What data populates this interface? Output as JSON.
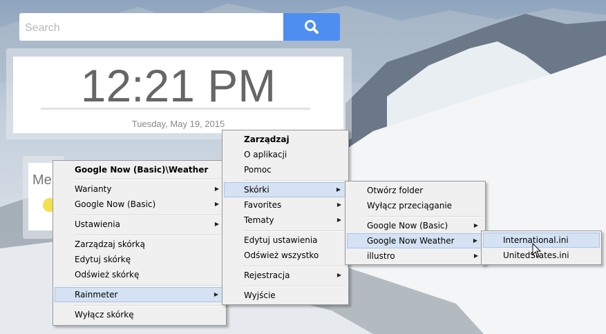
{
  "search": {
    "placeholder": "Search",
    "button_icon": "search-icon"
  },
  "clock": {
    "time": "12:21 PM",
    "date": "Tuesday, May 19, 2015"
  },
  "weather": {
    "text": "Me"
  },
  "colors": {
    "search_button": "#4d8ef0",
    "menu_bg": "#f0f0f0",
    "menu_highlight": "#d4e2f3"
  },
  "menu1": {
    "header": "Google Now (Basic)\\Weather",
    "items": [
      "Warianty",
      "Google Now (Basic)",
      "Ustawienia",
      "Zarządzaj skórką",
      "Edytuj skórkę",
      "Odśwież skórkę",
      "Rainmeter",
      "Wyłącz skórkę"
    ]
  },
  "menu2": {
    "items": [
      "Zarządzaj",
      "O aplikacji",
      "Pomoc",
      "Skórki",
      "Favorites",
      "Tematy",
      "Edytuj ustawienia",
      "Odśwież wszystko",
      "Rejestracja",
      "Wyjście"
    ]
  },
  "menu3": {
    "items": [
      "Otwórz folder",
      "Wyłącz przeciąganie",
      "Google Now (Basic)",
      "Google Now Weather",
      "illustro"
    ]
  },
  "menu4": {
    "items": [
      "International.ini",
      "UnitedStates.ini"
    ]
  }
}
